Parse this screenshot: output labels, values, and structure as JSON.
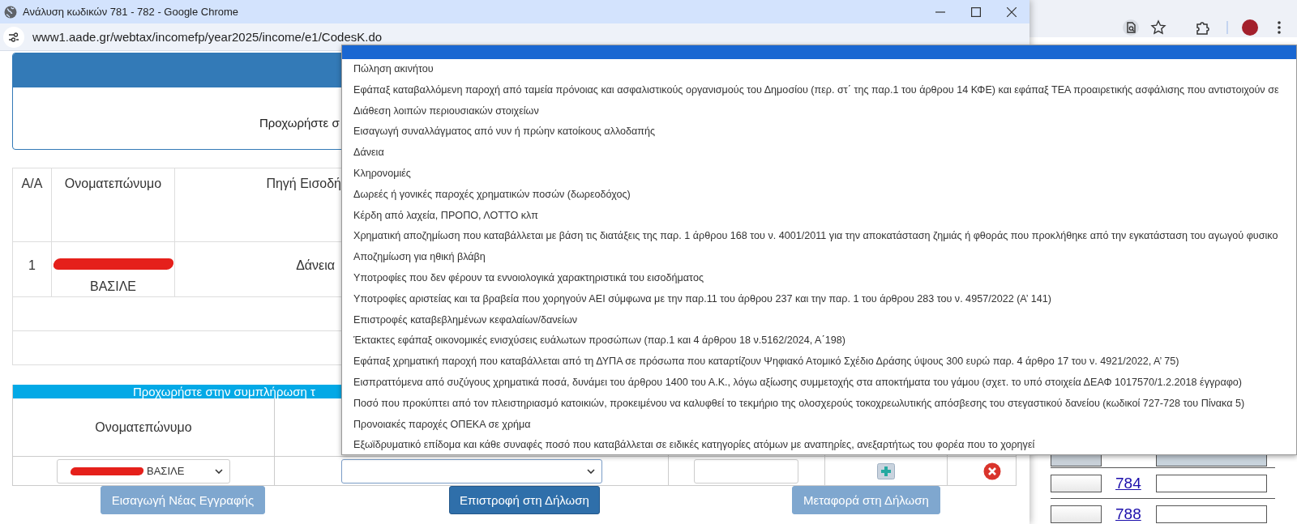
{
  "window": {
    "title": "Ανάλυση κωδικών 781 - 782 - Google Chrome",
    "url": "www1.aade.gr/webtax/incomefp/year2025/income/e1/CodesK.do"
  },
  "info_panel": {
    "text": "Προχωρήστε σ"
  },
  "income_table": {
    "columns": [
      "Α/Α",
      "Ονοματεπώνυμο",
      "Πηγή Εισοδή"
    ],
    "rows": [
      {
        "kind": "entry",
        "number": "1",
        "name": "ΒΑΣΙΛΕ",
        "name_redacted": true,
        "source": "Δάνεια"
      },
      {
        "kind": "empty"
      },
      {
        "kind": "empty"
      }
    ]
  },
  "entry_form": {
    "banner": "Προχωρήστε στην συμπλήρωση τ",
    "columns": [
      "Ονοματεπώνυμο"
    ],
    "name_select": {
      "value": "ΒΑΣΙΛΕ",
      "redacted": true
    },
    "buttons": [
      {
        "label": "Εισαγωγή Νέας Εγγραφής",
        "disabled": true
      },
      {
        "label": "Επιστροφή στη Δήλωση",
        "disabled": false
      },
      {
        "label": "Μεταφορά στη Δήλωση",
        "disabled": true
      }
    ]
  },
  "dropdown": {
    "blank_option": {
      "selected": true
    },
    "options": [
      {
        "label": "Πώληση ακινήτου",
        "selected": false
      },
      {
        "label": "Εφάπαξ καταβαλλόμενη παροχή από ταμεία πρόνοιας και ασφαλιστικούς οργανισμούς του Δημοσίου (περ. στ΄ της παρ.1 του άρθρου 14 ΚΦΕ) και εφάπαξ ΤΕΑ προαιρετικής ασφάλισης που αντιστοιχούν σε",
        "selected": false
      },
      {
        "label": "Διάθεση λοιπών περιουσιακών στοιχείων",
        "selected": false
      },
      {
        "label": "Εισαγωγή συναλλάγματος από νυν ή πρώην κατοίκους αλλοδαπής",
        "selected": false
      },
      {
        "label": "Δάνεια",
        "selected": false
      },
      {
        "label": "Κληρονομιές",
        "selected": false
      },
      {
        "label": "Δωρεές ή γονικές παροχές χρηματικών ποσών (δωρεοδόχος)",
        "selected": false
      },
      {
        "label": "Κέρδη από λαχεία, ΠΡΟΠΟ, ΛΟΤΤΟ κλπ",
        "selected": false
      },
      {
        "label": "Χρηματική αποζημίωση που καταβάλλεται με βάση τις διατάξεις της παρ. 1 άρθρου 168 του ν. 4001/2011 για την αποκατάσταση ζημιάς ή φθοράς που προκλήθηκε από την εγκατάσταση του αγωγού φυσικο",
        "selected": false
      },
      {
        "label": "Αποζημίωση για ηθική βλάβη",
        "selected": false
      },
      {
        "label": "Υποτροφίες που δεν φέρουν τα εννοιολογικά χαρακτηριστικά του εισοδήματος",
        "selected": false
      },
      {
        "label": "Υποτροφίες αριστείας και τα βραβεία που χορηγούν ΑΕΙ σύμφωνα με την παρ.11 του άρθρου 237 και την παρ. 1 του άρθρου 283 του ν. 4957/2022 (Α’ 141)",
        "selected": false
      },
      {
        "label": "Επιστροφές καταβεβλημένων κεφαλαίων/δανείων",
        "selected": false
      },
      {
        "label": "Έκτακτες εφάπαξ οικονομικές ενισχύσεις ευάλωτων προσώπων (παρ.1 και 4 άρθρου 18 ν.5162/2024, Α΄198)",
        "selected": false
      },
      {
        "label": "Εφάπαξ χρηματική παροχή που καταβάλλεται από τη ΔΥΠΑ σε πρόσωπα που καταρτίζουν Ψηφιακό Ατομικό Σχέδιο Δράσης ύψους 300 ευρώ παρ. 4 άρθρο 17 του ν. 4921/2022, Α’ 75)",
        "selected": false
      },
      {
        "label": "Εισπραττόμενα από συζύγους χρηματικά ποσά, δυνάμει του άρθρου 1400 του Α.Κ., λόγω αξίωσης συμμετοχής στα αποκτήματα του γάμου (σχετ. το υπό στοιχεία ΔΕΑΦ 1017570/1.2.2018 έγγραφο)",
        "selected": false
      },
      {
        "label": "Ποσό που προκύπτει από τον πλειστηριασμό κατοικιών, προκειμένου να καλυφθεί το τεκμήριο της ολοσχερούς τοκοχρεωλυτικής απόσβεσης του στεγαστικού δανείου (κωδικοί 727-728 του Πίνακα 5)",
        "selected": false
      },
      {
        "label": "Προνοιακές παροχές ΟΠΕΚΑ σε χρήμα",
        "selected": false
      },
      {
        "label": "Εξωϊδρυματικό επίδομα και κάθε συναφές ποσό που καταβάλλεται σε ειδικές κατηγορίες ατόμων με αναπηρίες, ανεξαρτήτως του φορέα που το χορηγεί",
        "selected": false
      }
    ]
  },
  "background_window": {
    "rows": [
      {
        "kind": "partial"
      },
      {
        "kind": "code",
        "code": "784"
      },
      {
        "kind": "code",
        "code": "788"
      }
    ]
  }
}
